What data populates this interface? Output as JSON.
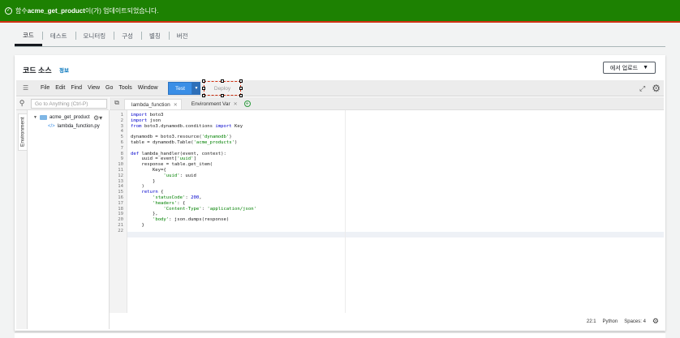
{
  "banner": {
    "prefix": "함수 ",
    "function_name": "acme_get_product",
    "suffix": "이(가) 업데이트되었습니다.",
    "background_color": "#1d8102",
    "icon": "check-circle-icon"
  },
  "tabs": [
    {
      "label": "코드",
      "active": true
    },
    {
      "label": "테스트"
    },
    {
      "label": "모니터링"
    },
    {
      "label": "구성"
    },
    {
      "label": "별칭"
    },
    {
      "label": "버전"
    }
  ],
  "code_source": {
    "title": "코드 소스",
    "info_link": "정보",
    "upload_button": "에서 업로드",
    "upload_icon": "caret-down-icon"
  },
  "ide": {
    "menu": [
      "File",
      "Edit",
      "Find",
      "View",
      "Go",
      "Tools",
      "Window"
    ],
    "test_button": "Test",
    "deploy_button": "Deploy",
    "search_placeholder": "Go to Anything (Ctrl-P)",
    "environment_label": "Environment",
    "tree": {
      "folder": "acme_get_product",
      "file": "lambda_function.py"
    },
    "editor_tabs": [
      {
        "label": "lambda_function",
        "active": true
      },
      {
        "label": "Environment Var"
      }
    ],
    "code_lines": [
      "import boto3",
      "import json",
      "from boto3.dynamodb.conditions import Key",
      "",
      "dynamodb = boto3.resource('dynamodb')",
      "table = dynamodb.Table('acme_products')",
      "",
      "def lambda_handler(event, context):",
      "    uuid = event['uuid']",
      "    response = table.get_item(",
      "        Key={",
      "            'uuid': uuid",
      "        }",
      "    )",
      "    return {",
      "        'statusCode': 200,",
      "        'headers': {",
      "            'Content-Type': 'application/json'",
      "        },",
      "        'body': json.dumps(response)",
      "    }",
      ""
    ],
    "status": {
      "cursor": "22:1",
      "language": "Python",
      "spaces": "Spaces: 4"
    }
  }
}
